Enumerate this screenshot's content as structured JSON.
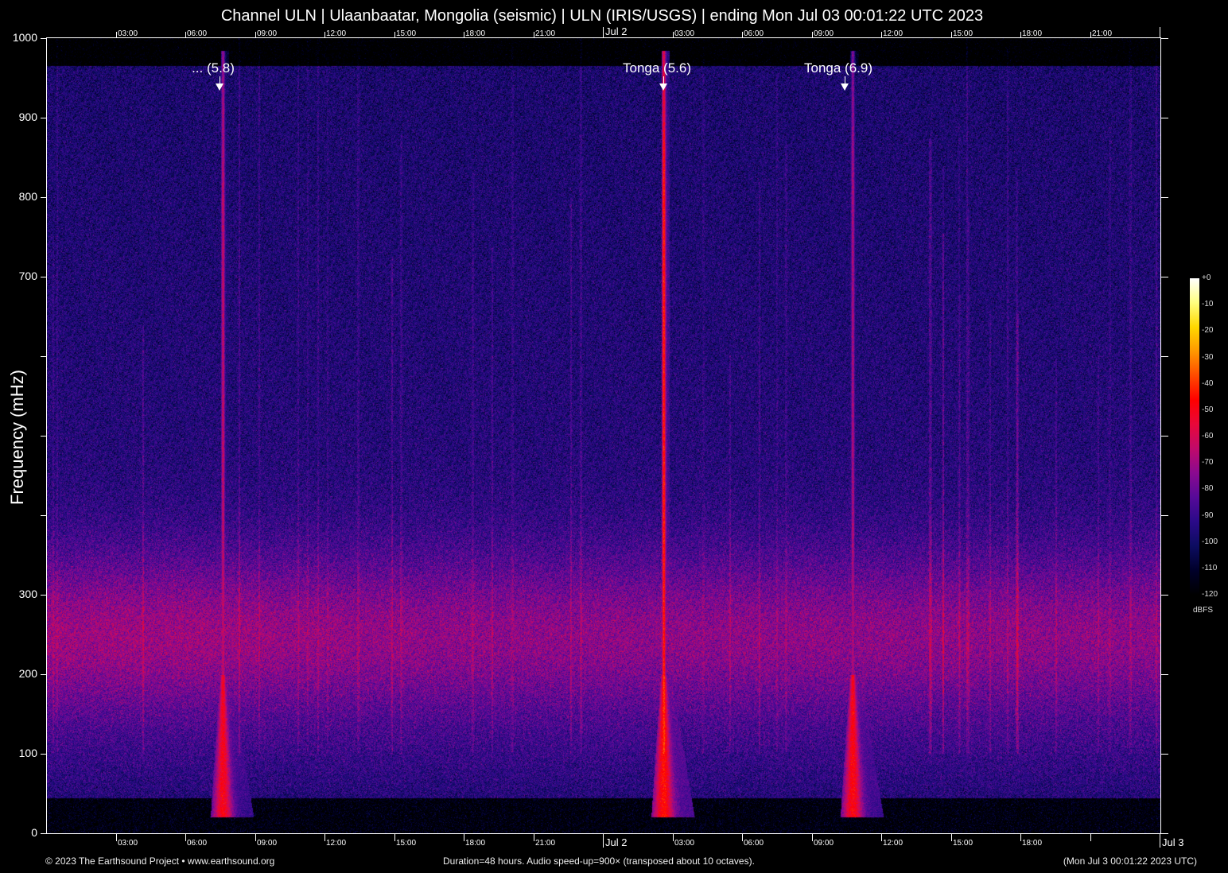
{
  "title": "Channel ULN | Ulaanbaatar, Mongolia (seismic) | ULN (IRIS/USGS) | ending Mon Jul 03 00:01:22 UTC 2023",
  "footer": {
    "copyright": "© 2023 The Earthsound Project • www.earthsound.org",
    "info": "Duration=48 hours. Audio speed-up=900× (transposed about 10 octaves).",
    "end_time": "(Mon Jul  3 00:01:22 2023 UTC)"
  },
  "chart_data": {
    "type": "heatmap",
    "subtype": "spectrogram",
    "ylabel": "Frequency (mHz)",
    "ylim": [
      0,
      1000
    ],
    "y_ticks": [
      0,
      100,
      200,
      300,
      400,
      500,
      600,
      700,
      800,
      900,
      1000
    ],
    "y_tick_labels": {
      "0": "0",
      "100": "100",
      "200": "200",
      "300": "300",
      "700": "700",
      "800": "800",
      "900": "900",
      "1000": "1000"
    },
    "xlim_hours": [
      0,
      48
    ],
    "x_start_offset_hours": 0.0228,
    "x_ticks_top": [
      {
        "h": 3,
        "label": "03:00"
      },
      {
        "h": 6,
        "label": "06:00"
      },
      {
        "h": 9,
        "label": "09:00"
      },
      {
        "h": 12,
        "label": "12:00"
      },
      {
        "h": 15,
        "label": "15:00"
      },
      {
        "h": 18,
        "label": "18:00"
      },
      {
        "h": 21,
        "label": "21:00"
      },
      {
        "h": 24,
        "label": "Jul  2",
        "big": true
      },
      {
        "h": 27,
        "label": "03:00"
      },
      {
        "h": 30,
        "label": "06:00"
      },
      {
        "h": 33,
        "label": "09:00"
      },
      {
        "h": 36,
        "label": "12:00"
      },
      {
        "h": 39,
        "label": "15:00"
      },
      {
        "h": 42,
        "label": "18:00"
      },
      {
        "h": 45,
        "label": "21:00"
      },
      {
        "h": 48,
        "label": ""
      }
    ],
    "x_ticks_bottom": [
      {
        "h": 3,
        "label": "03:00"
      },
      {
        "h": 6,
        "label": "06:00"
      },
      {
        "h": 9,
        "label": "09:00"
      },
      {
        "h": 12,
        "label": "12:00"
      },
      {
        "h": 15,
        "label": "15:00"
      },
      {
        "h": 18,
        "label": "18:00"
      },
      {
        "h": 21,
        "label": "21:00"
      },
      {
        "h": 24,
        "label": "Jul  2",
        "big": true
      },
      {
        "h": 27,
        "label": "03:00"
      },
      {
        "h": 30,
        "label": "06:00"
      },
      {
        "h": 33,
        "label": "09:00"
      },
      {
        "h": 36,
        "label": "12:00"
      },
      {
        "h": 39,
        "label": "15:00"
      },
      {
        "h": 42,
        "label": "18:00"
      },
      {
        "h": 45,
        "label": ""
      },
      {
        "h": 48,
        "label": "Jul  3",
        "big": true
      }
    ],
    "events": [
      {
        "label": "... (5.8)",
        "arrow_h": 7.45,
        "streak_h": 7.6,
        "peak_dbfs": -62,
        "low_freq_dbfs": -50
      },
      {
        "label": "Tonga (5.6)",
        "arrow_h": 26.6,
        "streak_h": 26.6,
        "peak_dbfs": -48,
        "low_freq_dbfs": -45
      },
      {
        "label": "Tonga (6.9)",
        "arrow_h": 34.4,
        "streak_h": 34.75,
        "peak_dbfs": -66,
        "low_freq_dbfs": -48
      }
    ],
    "colorbar": {
      "unit": "dBFS",
      "ticks": [
        "+0",
        "-10",
        "-20",
        "-30",
        "-40",
        "-50",
        "-60",
        "-70",
        "-80",
        "-90",
        "-100",
        "-110",
        "-120"
      ],
      "range": [
        -120,
        0
      ],
      "colors": [
        "#000000",
        "#00002a",
        "#0c0c60",
        "#2a0a88",
        "#560a98",
        "#8a0a90",
        "#c00a6a",
        "#e8083a",
        "#ff0000",
        "#ff4a00",
        "#ff9800",
        "#ffd800",
        "#ffff80",
        "#ffffff"
      ]
    }
  }
}
